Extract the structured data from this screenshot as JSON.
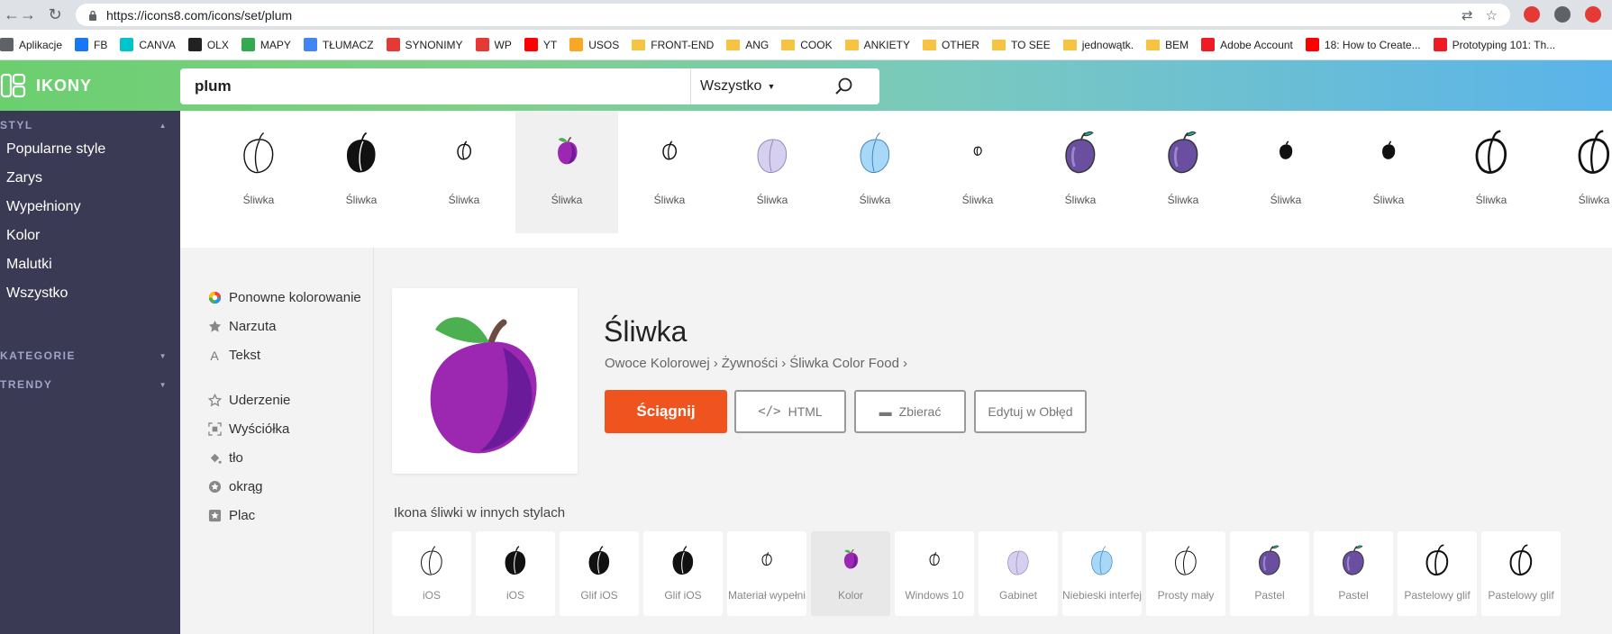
{
  "browser": {
    "url": "https://icons8.com/icons/set/plum",
    "bookmarks": [
      {
        "label": "Aplikacje",
        "icon": "apps-grid-icon"
      },
      {
        "label": "FB",
        "icon": "facebook-icon"
      },
      {
        "label": "CANVA",
        "icon": "canva-icon"
      },
      {
        "label": "OLX",
        "icon": "olx-icon"
      },
      {
        "label": "MAPY",
        "icon": "maps-icon"
      },
      {
        "label": "TŁUMACZ",
        "icon": "translate-icon"
      },
      {
        "label": "SYNONIMY",
        "icon": "synonimy-icon"
      },
      {
        "label": "WP",
        "icon": "wp-icon"
      },
      {
        "label": "YT",
        "icon": "youtube-icon"
      },
      {
        "label": "USOS",
        "icon": "usos-icon"
      },
      {
        "label": "FRONT-END",
        "icon": "folder-icon"
      },
      {
        "label": "ANG",
        "icon": "folder-icon"
      },
      {
        "label": "COOK",
        "icon": "folder-icon"
      },
      {
        "label": "ANKIETY",
        "icon": "folder-icon"
      },
      {
        "label": "OTHER",
        "icon": "folder-icon"
      },
      {
        "label": "TO SEE",
        "icon": "folder-icon"
      },
      {
        "label": "jednowątk.",
        "icon": "folder-icon"
      },
      {
        "label": "BEM",
        "icon": "folder-icon"
      },
      {
        "label": "Adobe Account",
        "icon": "adobe-icon"
      },
      {
        "label": "18: How to Create...",
        "icon": "youtube-icon"
      },
      {
        "label": "Prototyping 101: Th...",
        "icon": "adobe-icon"
      }
    ]
  },
  "header": {
    "logo": "IKONY",
    "search_value": "plum",
    "filter": "Wszystko"
  },
  "sidebar": {
    "style_heading": "STYL",
    "items": [
      "Popularne style",
      "Zarys",
      "Wypełniony",
      "Kolor",
      "Malutki",
      "Wszystko"
    ],
    "categories_heading": "KATEGORIE",
    "trends_heading": "TRENDY"
  },
  "strip": {
    "items": [
      {
        "label": "Śliwka",
        "style": "outline"
      },
      {
        "label": "Śliwka",
        "style": "filled"
      },
      {
        "label": "Śliwka",
        "style": "small-outline"
      },
      {
        "label": "Śliwka",
        "style": "color",
        "selected": true
      },
      {
        "label": "Śliwka",
        "style": "small-outline"
      },
      {
        "label": "Śliwka",
        "style": "lavender"
      },
      {
        "label": "Śliwka",
        "style": "light-blue"
      },
      {
        "label": "Śliwka",
        "style": "tiny-outline"
      },
      {
        "label": "Śliwka",
        "style": "pastel"
      },
      {
        "label": "Śliwka",
        "style": "pastel"
      },
      {
        "label": "Śliwka",
        "style": "small-filled"
      },
      {
        "label": "Śliwka",
        "style": "small-filled"
      },
      {
        "label": "Śliwka",
        "style": "glyph-outline"
      },
      {
        "label": "Śliwka",
        "style": "glyph-outline"
      }
    ]
  },
  "tools": {
    "recolor": "Ponowne kolorowanie",
    "overlay": "Narzuta",
    "text": "Tekst",
    "stroke": "Uderzenie",
    "padding": "Wyściółka",
    "background": "tło",
    "circle": "okrąg",
    "square": "Plac"
  },
  "detail": {
    "title": "Śliwka",
    "breadcrumb": [
      "Owoce Kolorowej",
      "Żywności",
      "Śliwka Color Food"
    ],
    "download": "Ściągnij",
    "html": "HTML",
    "collect": "Zbierać",
    "edit": "Edytuj w Obłęd"
  },
  "other_styles": {
    "title": "Ikona śliwki w innych stylach",
    "items": [
      {
        "label": "iOS",
        "style": "outline"
      },
      {
        "label": "iOS",
        "style": "filled"
      },
      {
        "label": "Glif iOS",
        "style": "filled"
      },
      {
        "label": "Glif iOS",
        "style": "filled"
      },
      {
        "label": "Materiał wypełni",
        "style": "small-outline"
      },
      {
        "label": "Kolor",
        "style": "color",
        "selected": true
      },
      {
        "label": "Windows 10",
        "style": "small-outline"
      },
      {
        "label": "Gabinet",
        "style": "lavender"
      },
      {
        "label": "Niebieski interfej",
        "style": "light-blue"
      },
      {
        "label": "Prosty mały",
        "style": "outline"
      },
      {
        "label": "Pastel",
        "style": "pastel"
      },
      {
        "label": "Pastel",
        "style": "pastel"
      },
      {
        "label": "Pastelowy glif",
        "style": "glyph-outline"
      },
      {
        "label": "Pastelowy glif",
        "style": "glyph-outline"
      }
    ]
  },
  "colors": {
    "accent": "#f0541e",
    "sidebar": "#3b3a54",
    "plum": "#9b27b0",
    "leaf": "#4caf50"
  }
}
